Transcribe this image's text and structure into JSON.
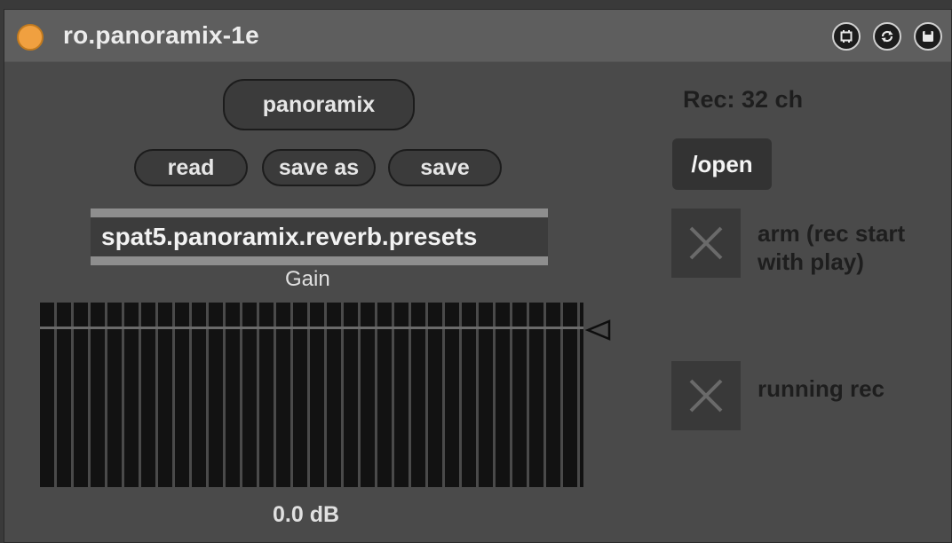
{
  "device": {
    "title": "ro.panoramix-1e",
    "led_color": "#f0a040",
    "title_buttons": [
      {
        "icon": "freeze-device-icon"
      },
      {
        "icon": "refresh-icon"
      },
      {
        "icon": "save-device-icon"
      }
    ]
  },
  "panel": {
    "panoramix_button": "panoramix",
    "read_button": "read",
    "save_as_button": "save as",
    "save_button": "save",
    "preset_menu": {
      "selected": "spat5.panoramix.reverb.presets"
    },
    "gain_label": "Gain",
    "gain_value": "0.0 dB",
    "meter": {
      "channels": 32,
      "level": 0.0
    }
  },
  "recorder": {
    "rec_label": "Rec: 32 ch",
    "open_button": "/open",
    "arm_label": "arm (rec start with play)",
    "arm_state": false,
    "running_label": "running rec",
    "running_state": false
  }
}
